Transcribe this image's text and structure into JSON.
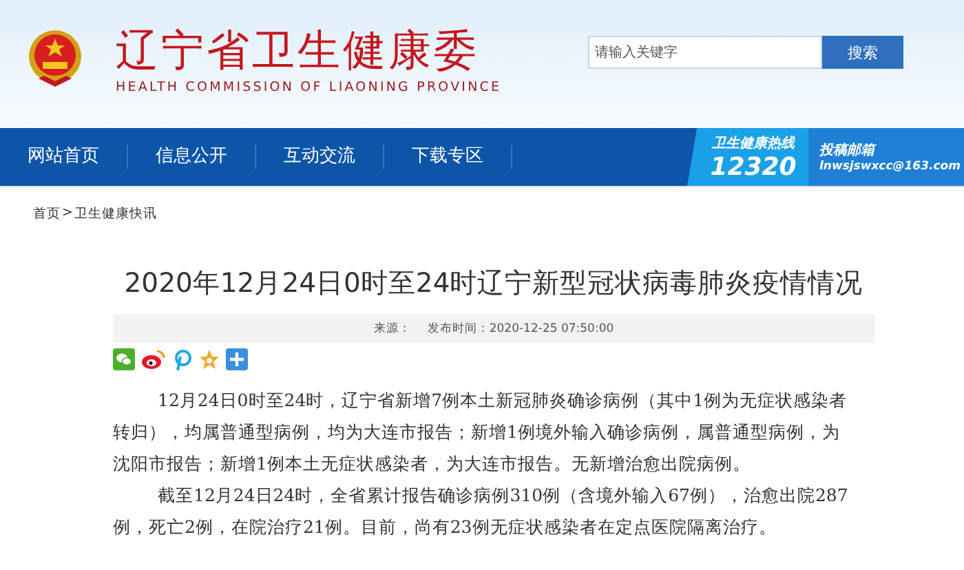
{
  "header": {
    "title": "辽宁省卫生健康委",
    "subtitle": "HEALTH COMMISSION OF LIAONING PROVINCE",
    "search": {
      "placeholder": "请输入关键字",
      "button": "搜索"
    }
  },
  "nav": {
    "items": [
      "网站首页",
      "信息公开",
      "互动交流",
      "下载专区"
    ],
    "hotline": {
      "label": "卫生健康热线",
      "number": "12320"
    },
    "mailbox": {
      "label": "投稿邮箱",
      "email": "lnwsjswxcc@163.com"
    }
  },
  "breadcrumb": [
    "首页",
    ">",
    "卫生健康快讯"
  ],
  "article": {
    "title": "2020年12月24日0时至24时辽宁新型冠状病毒肺炎疫情情况",
    "source": "来源：",
    "published": "发布时间：2020-12-25 07:50:00",
    "share": [
      {
        "kind": "wechat"
      },
      {
        "kind": "weibo"
      },
      {
        "kind": "pin"
      },
      {
        "kind": "star"
      },
      {
        "kind": "plus"
      }
    ],
    "paragraphs": [
      "12月24日0时至24时，辽宁省新增7例本土新冠肺炎确诊病例（其中1例为无症状感染者转归），均属普通型病例，均为大连市报告；新增1例境外输入确诊病例，属普通型病例，为沈阳市报告；新增1例本土无症状感染者，为大连市报告。无新增治愈出院病例。",
      "截至12月24日24时，全省累计报告确诊病例310例（含境外输入67例），治愈出院287例，死亡2例，在院治疗21例。目前，尚有23例无症状感染者在定点医院隔离治疗。"
    ]
  }
}
